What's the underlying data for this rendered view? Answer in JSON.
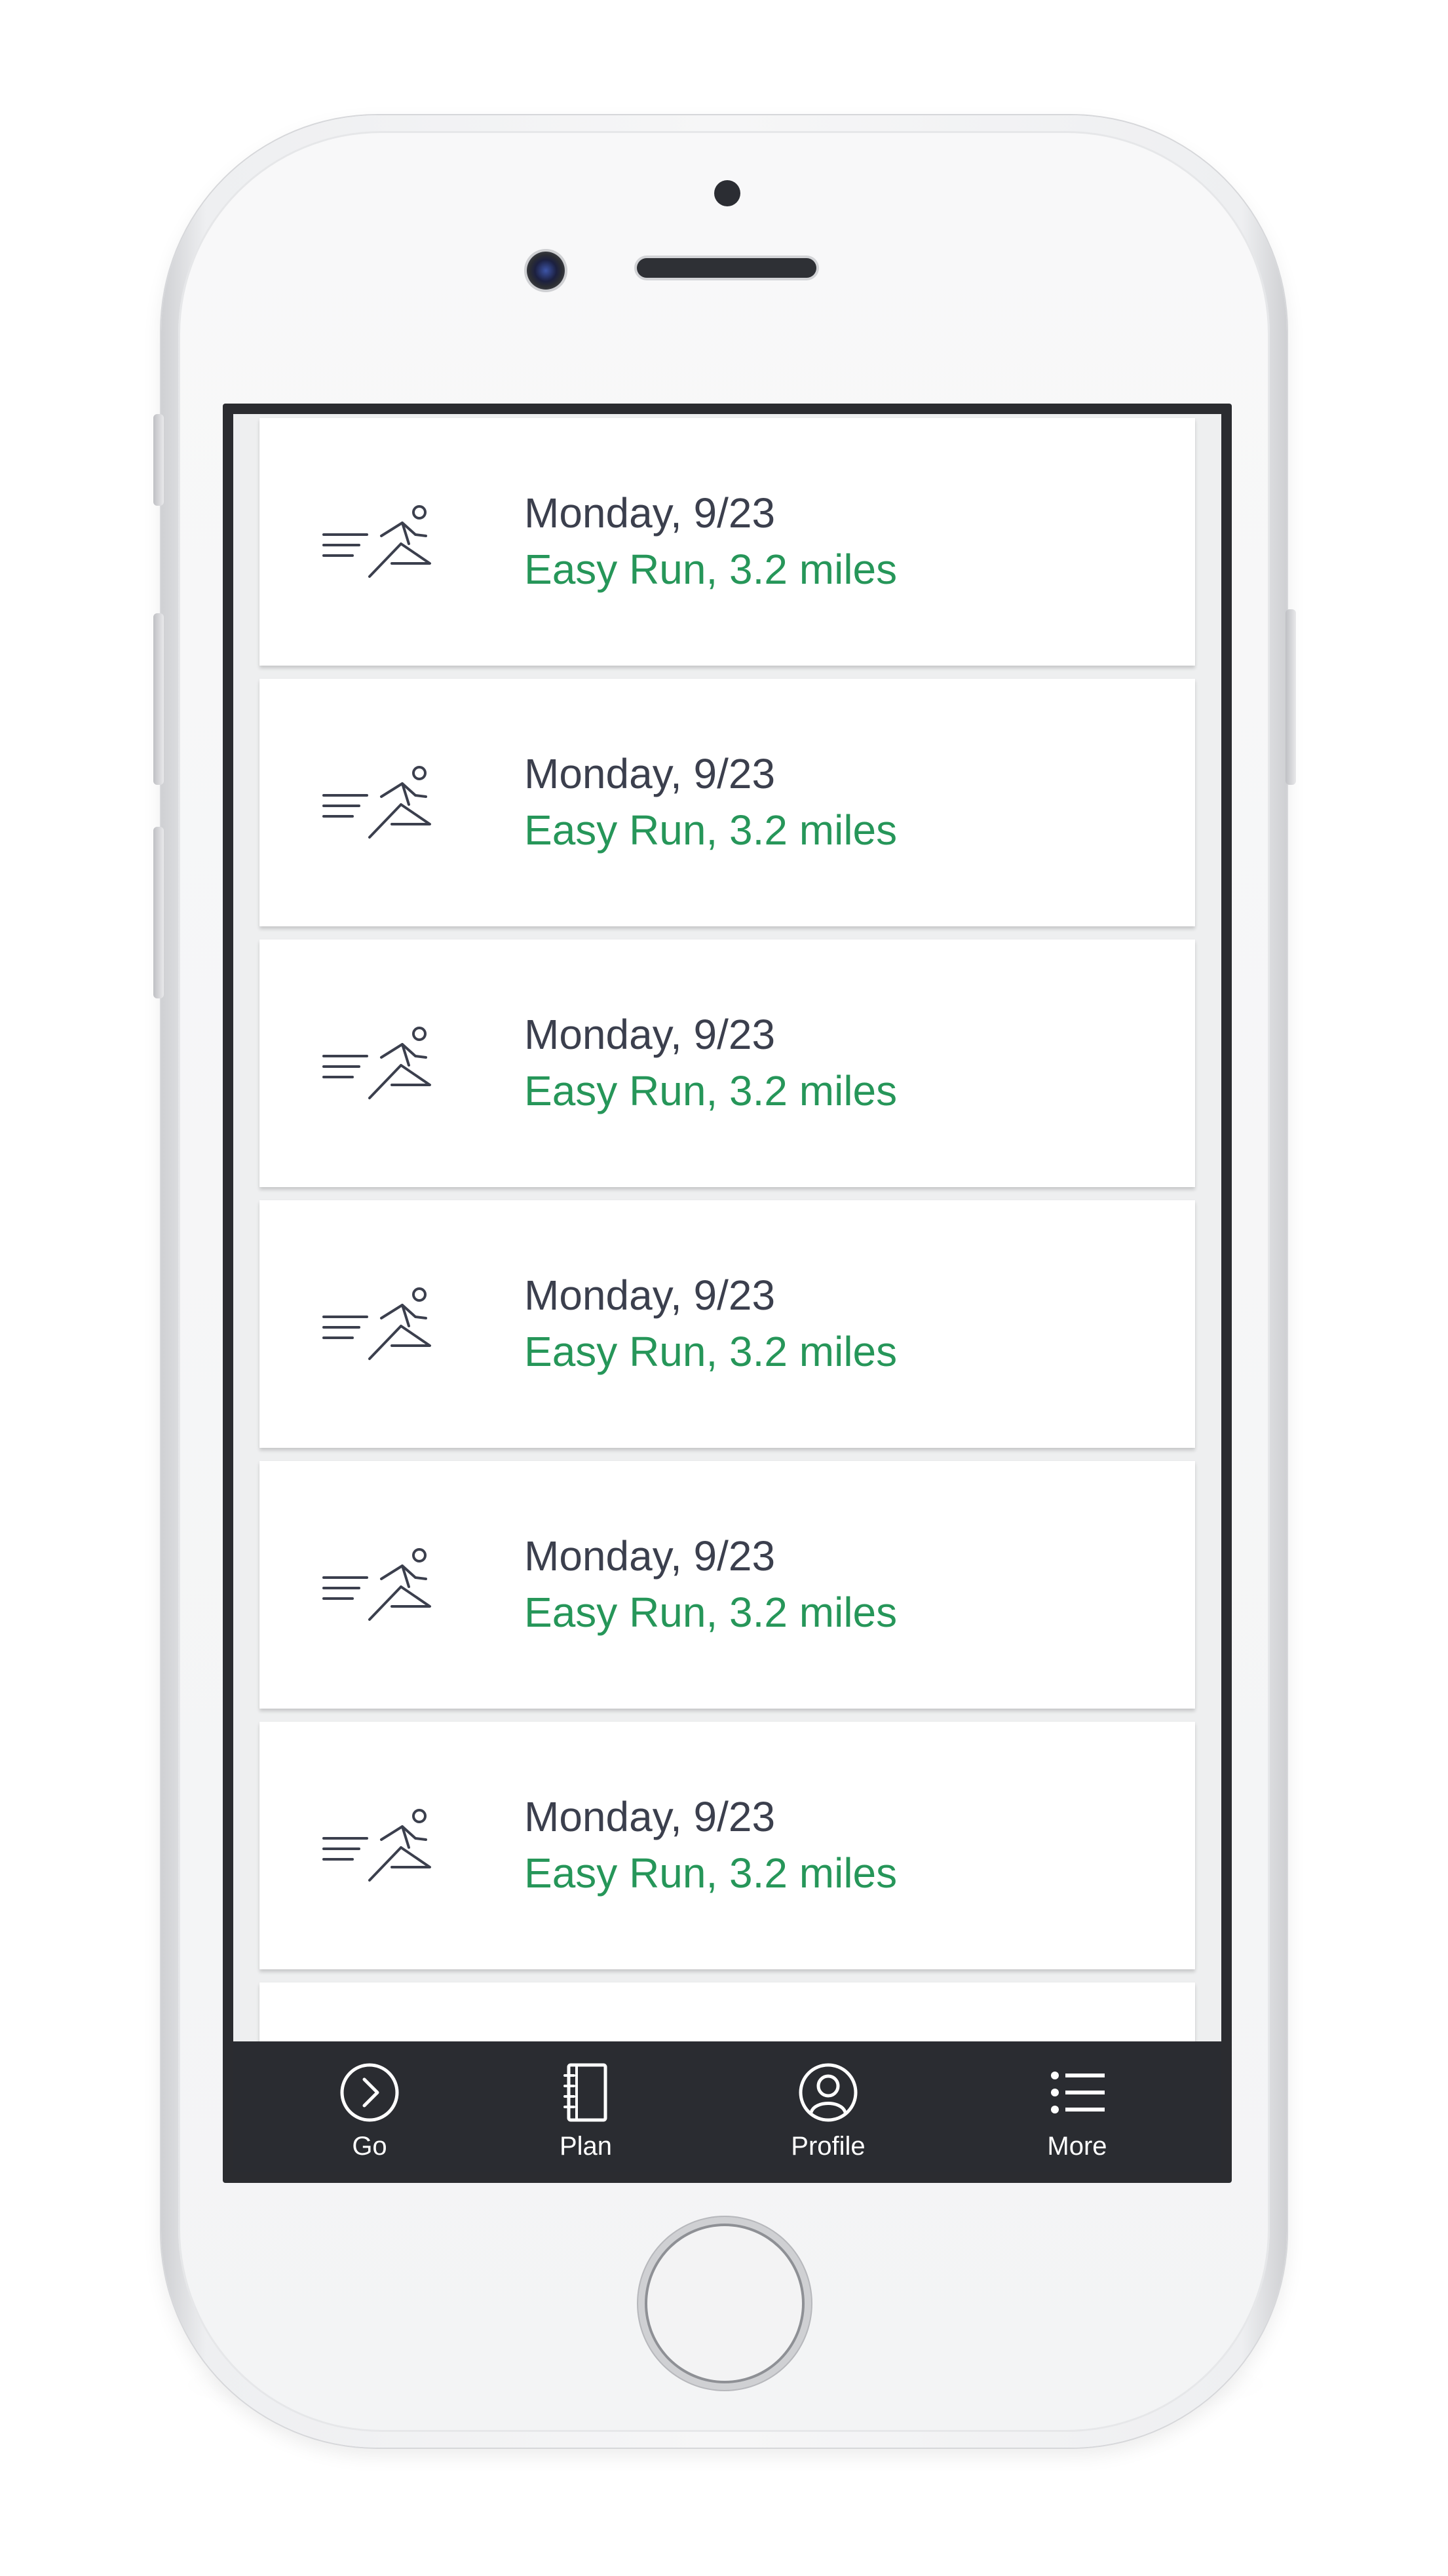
{
  "runs": [
    {
      "date": "Monday, 9/23",
      "description": "Easy Run, 3.2 miles",
      "icon": "runner-icon"
    },
    {
      "date": "Monday, 9/23",
      "description": "Easy Run, 3.2 miles",
      "icon": "runner-icon"
    },
    {
      "date": "Monday, 9/23",
      "description": "Easy Run, 3.2 miles",
      "icon": "runner-icon"
    },
    {
      "date": "Monday, 9/23",
      "description": "Easy Run, 3.2 miles",
      "icon": "runner-icon"
    },
    {
      "date": "Monday, 9/23",
      "description": "Easy Run, 3.2 miles",
      "icon": "runner-icon"
    },
    {
      "date": "Monday, 9/23",
      "description": "Easy Run, 3.2 miles",
      "icon": "runner-icon"
    }
  ],
  "tab_bar": {
    "tabs": [
      {
        "label": "Go",
        "icon": "go-chevron-icon"
      },
      {
        "label": "Plan",
        "icon": "notebook-icon"
      },
      {
        "label": "Profile",
        "icon": "profile-icon"
      },
      {
        "label": "More",
        "icon": "list-icon"
      }
    ]
  },
  "colors": {
    "date_text": "#3b3f4d",
    "run_text": "#269659",
    "tab_bar_bg": "#2a2c31",
    "tab_text": "#ffffff"
  }
}
